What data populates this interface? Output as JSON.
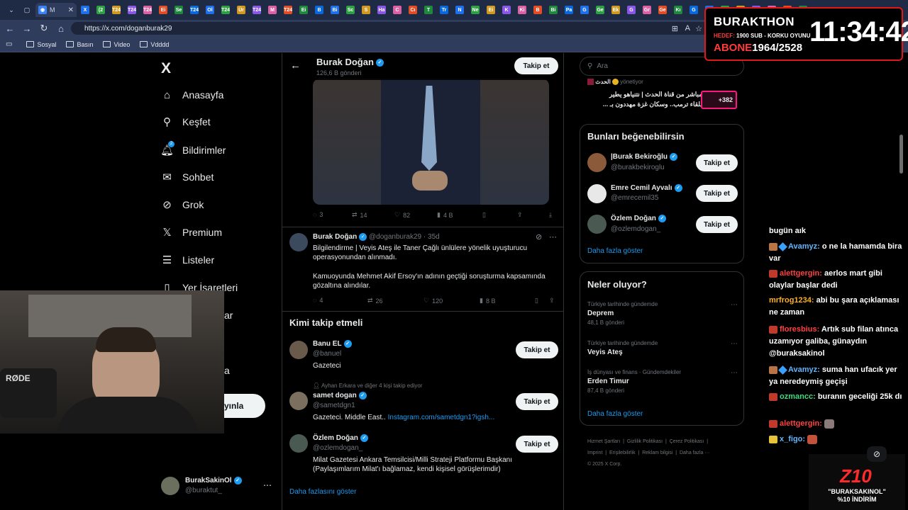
{
  "browser": {
    "active_tab_label": "M",
    "url": "https://x.com/doganburak29",
    "bookmarks": [
      "Sosyal",
      "Basın",
      "Video",
      "Vdddd"
    ],
    "tabs": [
      "X",
      "(2",
      "T24",
      "T24",
      "T24",
      "Ei",
      "Se",
      "T24",
      "Ol",
      "T24",
      "Ür",
      "T24",
      "M",
      "T24",
      "Ei",
      "B",
      "Bi",
      "Sc",
      "S",
      "Ha",
      "C",
      "Cı",
      "T",
      "Tr",
      "N",
      "Ne",
      "Ei",
      "K",
      "Ki",
      "B",
      "Bi",
      "Pa",
      "G",
      "Ge",
      "Ek",
      "G",
      "Gr",
      "Ge",
      "Kı",
      "G",
      "Ge",
      "Sc",
      "Hı",
      "10",
      "10",
      "X",
      "x"
    ]
  },
  "stream_overlay": {
    "name": "BURAKTHON",
    "subline_red": "HEDEF:",
    "subline": "1900 SUB - KORKU OYUNU",
    "abone_label": "ABONE",
    "abone_value": "1964/2528",
    "clock": "11:34:42"
  },
  "sidebar": {
    "logo": "X",
    "items": [
      {
        "label": "Anasayfa",
        "icon": "home-icon"
      },
      {
        "label": "Keşfet",
        "icon": "search-icon"
      },
      {
        "label": "Bildirimler",
        "icon": "bell-icon"
      },
      {
        "label": "Sohbet",
        "icon": "mail-icon"
      },
      {
        "label": "Grok",
        "icon": "grok-icon"
      },
      {
        "label": "Premium",
        "icon": "x-icon"
      },
      {
        "label": "Listeler",
        "icon": "list-icon"
      },
      {
        "label": "Yer İşaretleri",
        "icon": "bookmark-icon"
      }
    ],
    "badge": "2",
    "post_button_partial": "yınla",
    "partial_label_1": "ar",
    "partial_label_2": "a",
    "profile": {
      "name": "BurakSakinOl",
      "handle": "@buraktut_"
    }
  },
  "main": {
    "header": {
      "name": "Burak Doğan",
      "posts": "126,6 B gönderi",
      "follow": "Takip et"
    },
    "tweet1_stats": {
      "replies": "3",
      "retweets": "14",
      "likes": "82",
      "views": "4 B"
    },
    "tweet2": {
      "name": "Burak Doğan",
      "handle": "@doganburak29",
      "time": "· 35d",
      "text1": "Bilgilendirme | Veyis Ateş ile Taner Çağlı ünlülere yönelik uyuşturucu operasyonundan alınmadı.",
      "text2": "Kamuoyunda Mehmet Akif Ersoy'ın adının geçtiği soruşturma kapsamında gözaltına alındılar.",
      "replies": "4",
      "retweets": "26",
      "likes": "120",
      "views": "8 B"
    },
    "who_to_follow": {
      "title": "Kimi takip etmeli",
      "users": [
        {
          "name": "Banu EL",
          "handle": "@banuel",
          "bio": "Gazeteci",
          "social": "",
          "follow": "Takip et"
        },
        {
          "name": "samet dogan",
          "handle": "@sametdgn1",
          "bio": "Gazeteci. Middle East..",
          "link": "Instagram.com/sametdgn1?igsh...",
          "social": "Ayhan Erkara ve diğer 4 kişi takip ediyor",
          "follow": "Takip et"
        },
        {
          "name": "Özlem Doğan",
          "handle": "@ozlemdogan_",
          "bio": "Milat Gazetesi Ankara Temsilcisi/Milli Strateji Platformu Başkanı (Paylaşımlarım Milat'ı bağlamaz, kendi kişisel görüşlerimdir)",
          "social": "",
          "follow": "Takip et"
        }
      ],
      "more": "Daha fazlasını göster"
    }
  },
  "right": {
    "search_placeholder": "Ara",
    "spaces": {
      "host_label": "yönetiyor",
      "host_name": "الحدث",
      "text1": "مباشر من قناة الحدث | نتنياهو يطير",
      "text2": "للقاء ترمب.. وسكان غزة مهددون بـ ...",
      "count": "+382"
    },
    "suggest": {
      "title": "Bunları beğenebilirsin",
      "users": [
        {
          "name": "|Burak Bekiroğlu",
          "handle": "@burakbekiroglu",
          "follow": "Takip et"
        },
        {
          "name": "Emre Cemil Ayvalı",
          "handle": "@emrecemil35",
          "follow": "Takip et"
        },
        {
          "name": "Özlem Doğan",
          "handle": "@ozlemdogan_",
          "follow": "Takip et"
        }
      ],
      "more": "Daha fazla göster"
    },
    "trends": {
      "title": "Neler oluyor?",
      "items": [
        {
          "meta": "Türkiye tarihinde gündemde",
          "name": "Deprem",
          "count": "48,1 B gönderi"
        },
        {
          "meta": "Türkiye tarihinde gündemde",
          "name": "Veyis Ateş",
          "count": ""
        },
        {
          "meta": "İş dünyası ve finans · Gündemdekiler",
          "name": "Erden Timur",
          "count": "87,4 B gönderi"
        }
      ],
      "more": "Daha fazla göster"
    },
    "footer": {
      "line1": [
        "Hizmet Şartları",
        "Gizlilik Politikası",
        "Çerez Politikası"
      ],
      "line2": [
        "Imprint",
        "Erişilebilirlik",
        "Reklam bilgisi",
        "Daha fazla ···"
      ],
      "copyright": "© 2025 X Corp."
    }
  },
  "chat": {
    "messages": [
      {
        "user": "",
        "text": "bugün aık"
      },
      {
        "user": "Avamyz:",
        "text": "o ne la hamamda bira var",
        "color": "#5fb6ff"
      },
      {
        "user": "alettgergin:",
        "text": "aerlos mart gibi olaylar başlar dedi",
        "color": "#ff4040"
      },
      {
        "user": "mrfrog1234:",
        "text": "abi bu şara açıklaması ne zaman",
        "color": "#ffb020"
      },
      {
        "user": "floresbius:",
        "text": "Artık sub filan atınca uzamıyor galiba, günaydın @buraksakinol",
        "color": "#ff4040"
      },
      {
        "user": "Avamyz:",
        "text": "suma han ufacık yer ya neredeymiş geçişi",
        "color": "#5fb6ff"
      },
      {
        "user": "ozmancc:",
        "text": "buranın geceliği 25k dı",
        "color": "#3ddc84"
      },
      {
        "user": "alettgergin:",
        "text": "",
        "color": "#ff4040"
      },
      {
        "user": "x_figo:",
        "text": "",
        "color": "#5fb6ff"
      }
    ],
    "promo": {
      "logo": "Z10",
      "line1": "\"BURAKSAKINOL\"",
      "line2": "%10 İNDİRİM"
    }
  },
  "webcam": {
    "mic_brand": "RØDE"
  }
}
